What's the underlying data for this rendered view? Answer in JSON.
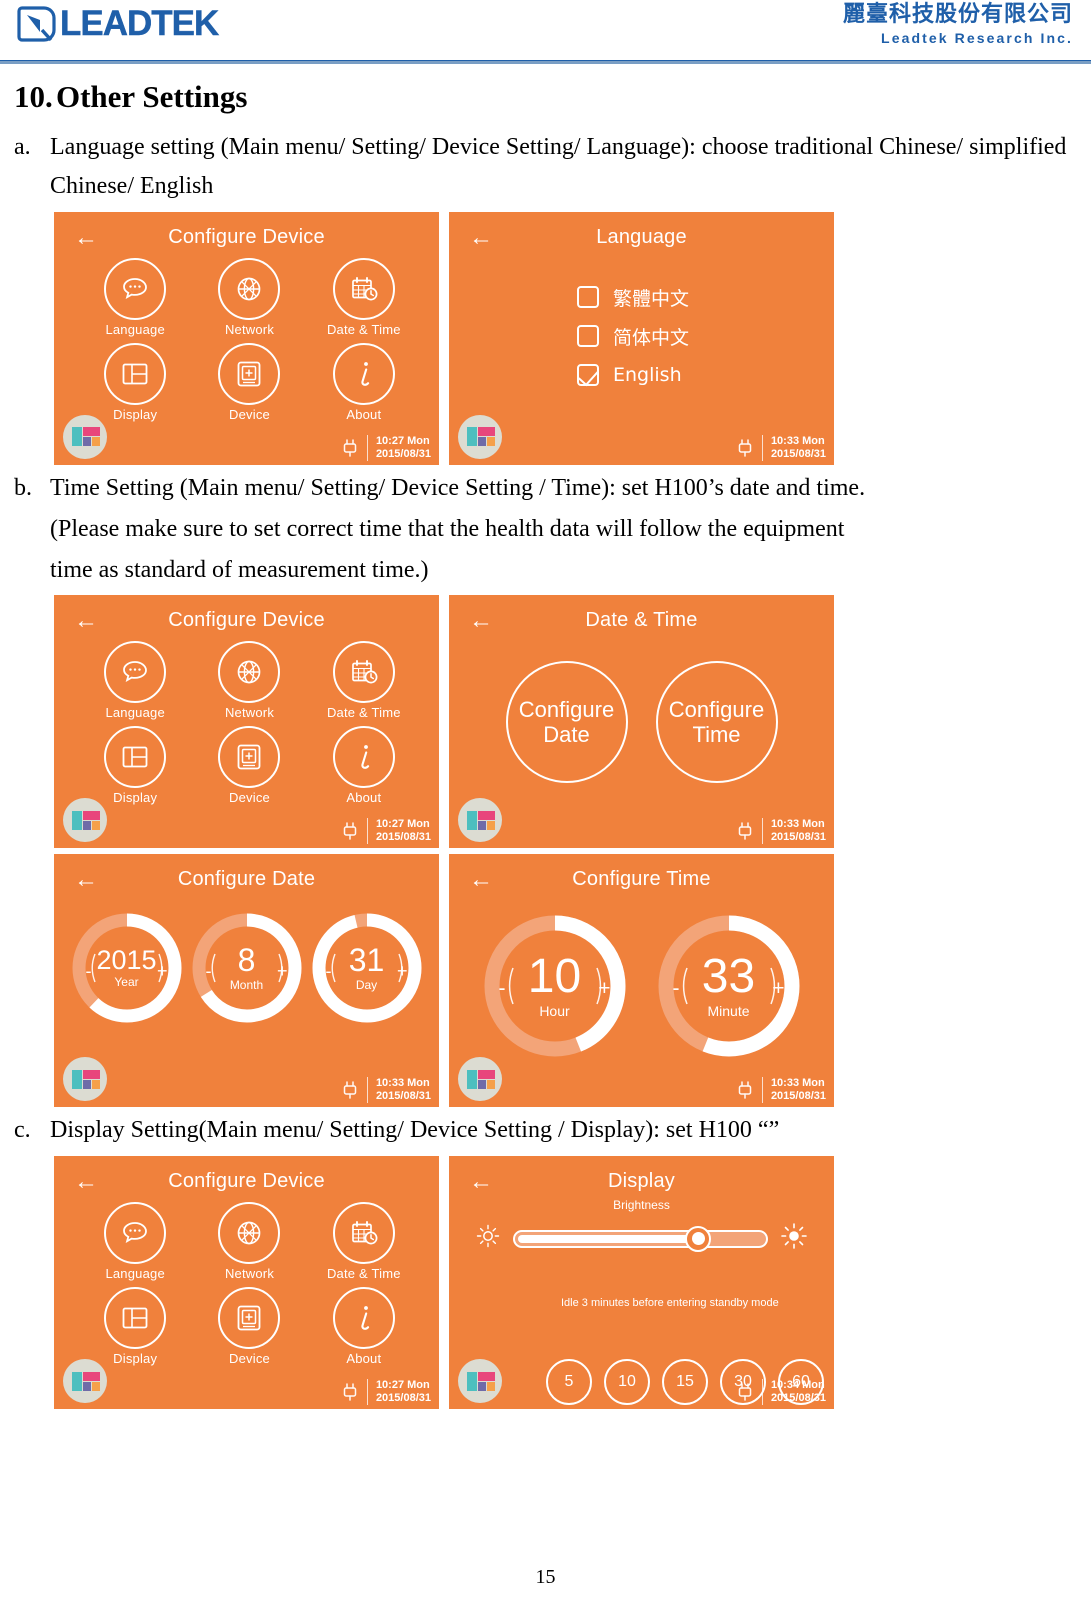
{
  "header": {
    "logo_text": "LEADTEK",
    "company_cn": "麗臺科技股份有限公司",
    "company_en": "Leadtek Research Inc."
  },
  "document": {
    "section_number": "10.",
    "section_title": "Other Settings",
    "items": [
      {
        "marker": "a.",
        "text": "Language setting (Main menu/ Setting/ Device Setting/ Language): choose traditional Chinese/ simplified Chinese/ English"
      },
      {
        "marker": "b.",
        "line1": "Time Setting (Main menu/ Setting/ Device Setting / Time): set H100’s date and time.",
        "line2": "(Please make sure to set correct time that the health data will follow the equipment",
        "line3": "time as standard of measurement time.)"
      },
      {
        "marker": "c.",
        "text": "Display Setting(Main menu/ Setting/ Device Setting / Display): set H100 “”"
      }
    ],
    "page_number": "15"
  },
  "screens": {
    "configure_device_1": {
      "title": "Configure Device",
      "back_icon": "back-arrow-icon",
      "menu": [
        {
          "label": "Language",
          "icon": "speech-bubble-icon"
        },
        {
          "label": "Network",
          "icon": "globe-network-icon"
        },
        {
          "label": "Date & Time",
          "icon": "calendar-clock-icon"
        },
        {
          "label": "Display",
          "icon": "layout-display-icon"
        },
        {
          "label": "Device",
          "icon": "device-plus-icon"
        },
        {
          "label": "About",
          "icon": "info-italic-icon"
        }
      ],
      "footer": {
        "time": "10:27 Mon",
        "date": "2015/08/31",
        "power_icon": "plug-icon"
      }
    },
    "language": {
      "title": "Language",
      "back_icon": "back-arrow-icon",
      "options": [
        {
          "label": "繁體中文",
          "checked": false
        },
        {
          "label": "简体中文",
          "checked": false
        },
        {
          "label": "English",
          "checked": true
        }
      ],
      "footer": {
        "time": "10:33 Mon",
        "date": "2015/08/31",
        "power_icon": "plug-icon"
      }
    },
    "configure_device_2": {
      "title": "Configure Device",
      "back_icon": "back-arrow-icon",
      "menu": [
        {
          "label": "Language",
          "icon": "speech-bubble-icon"
        },
        {
          "label": "Network",
          "icon": "globe-network-icon"
        },
        {
          "label": "Date & Time",
          "icon": "calendar-clock-icon"
        },
        {
          "label": "Display",
          "icon": "layout-display-icon"
        },
        {
          "label": "Device",
          "icon": "device-plus-icon"
        },
        {
          "label": "About",
          "icon": "info-italic-icon"
        }
      ],
      "footer": {
        "time": "10:27 Mon",
        "date": "2015/08/31",
        "power_icon": "plug-icon"
      }
    },
    "date_time": {
      "title": "Date & Time",
      "back_icon": "back-arrow-icon",
      "buttons": [
        {
          "line1": "Configure",
          "line2": "Date"
        },
        {
          "line1": "Configure",
          "line2": "Time"
        }
      ],
      "footer": {
        "time": "10:33 Mon",
        "date": "2015/08/31",
        "power_icon": "plug-icon"
      }
    },
    "configure_date": {
      "title": "Configure Date",
      "back_icon": "back-arrow-icon",
      "rings": [
        {
          "value": "2015",
          "unit": "Year",
          "progress": 0.62,
          "minus": "-",
          "plus": "+"
        },
        {
          "value": "8",
          "unit": "Month",
          "progress": 0.66,
          "minus": "-",
          "plus": "+"
        },
        {
          "value": "31",
          "unit": "Day",
          "progress": 0.96,
          "minus": "-",
          "plus": "+"
        }
      ],
      "footer": {
        "time": "10:33 Mon",
        "date": "2015/08/31",
        "power_icon": "plug-icon"
      }
    },
    "configure_time": {
      "title": "Configure Time",
      "back_icon": "back-arrow-icon",
      "rings": [
        {
          "value": "10",
          "unit": "Hour",
          "progress": 0.44,
          "minus": "-",
          "plus": "+"
        },
        {
          "value": "33",
          "unit": "Minute",
          "progress": 0.56,
          "minus": "-",
          "plus": "+"
        }
      ],
      "footer": {
        "time": "10:33 Mon",
        "date": "2015/08/31",
        "power_icon": "plug-icon"
      }
    },
    "configure_device_3": {
      "title": "Configure Device",
      "back_icon": "back-arrow-icon",
      "menu": [
        {
          "label": "Language",
          "icon": "speech-bubble-icon"
        },
        {
          "label": "Network",
          "icon": "globe-network-icon"
        },
        {
          "label": "Date & Time",
          "icon": "calendar-clock-icon"
        },
        {
          "label": "Display",
          "icon": "layout-display-icon"
        },
        {
          "label": "Device",
          "icon": "device-plus-icon"
        },
        {
          "label": "About",
          "icon": "info-italic-icon"
        }
      ],
      "footer": {
        "time": "10:27 Mon",
        "date": "2015/08/31",
        "power_icon": "plug-icon"
      }
    },
    "display": {
      "title": "Display",
      "back_icon": "back-arrow-icon",
      "brightness_label": "Brightness",
      "brightness_value": 73,
      "low_icon": "sun-low-icon",
      "high_icon": "sun-high-icon",
      "standby_text": "Idle 3 minutes before entering standby mode",
      "timers": [
        "5",
        "10",
        "15",
        "30",
        "60"
      ],
      "footer": {
        "time": "10:34 Mon",
        "date": "2015/08/31",
        "power_icon": "plug-icon"
      }
    }
  },
  "colors": {
    "screen_bg": "#F0813C",
    "ring_track": "#F3A478",
    "brand_blue": "#1F5FA9",
    "home_teal": "#4DBFBF",
    "home_pink": "#E8467C",
    "home_purple": "#6F6BA8",
    "home_orange": "#F5A04A"
  }
}
